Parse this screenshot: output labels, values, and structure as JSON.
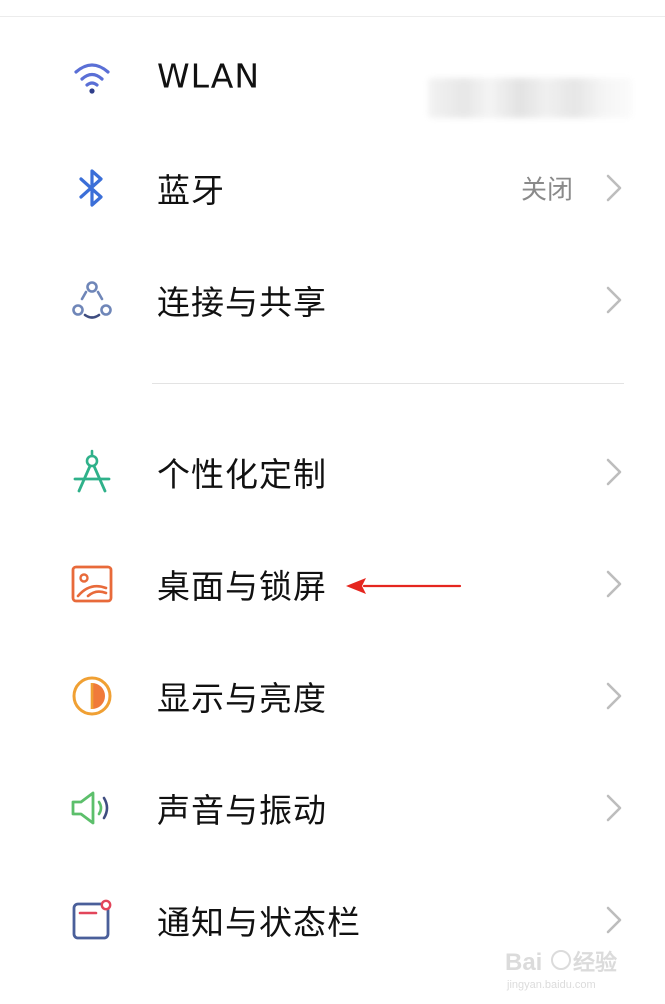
{
  "settings": {
    "rows": [
      {
        "label": "WLAN",
        "value": "",
        "icon": "wifi-icon",
        "color": "#5a6fd6"
      },
      {
        "label": "蓝牙",
        "value": "关闭",
        "icon": "bluetooth-icon",
        "color": "#3b6fd8"
      },
      {
        "label": "连接与共享",
        "value": "",
        "icon": "share-connection-icon",
        "color": "#6f86b8"
      },
      {
        "label": "个性化定制",
        "value": "",
        "icon": "compass-icon",
        "color": "#2fb18a"
      },
      {
        "label": "桌面与锁屏",
        "value": "",
        "icon": "wallpaper-icon",
        "color": "#e86a3a"
      },
      {
        "label": "显示与亮度",
        "value": "",
        "icon": "brightness-icon",
        "color": "#f0a033"
      },
      {
        "label": "声音与振动",
        "value": "",
        "icon": "speaker-icon",
        "color": "#5cbf6b"
      },
      {
        "label": "通知与状态栏",
        "value": "",
        "icon": "notification-icon",
        "color": "#4a5f9a"
      }
    ]
  },
  "annotation": {
    "color": "#e5261f"
  },
  "watermark": {
    "brand": "Baidu",
    "sub": "经验",
    "domain": "jingyan.baidu.com"
  }
}
